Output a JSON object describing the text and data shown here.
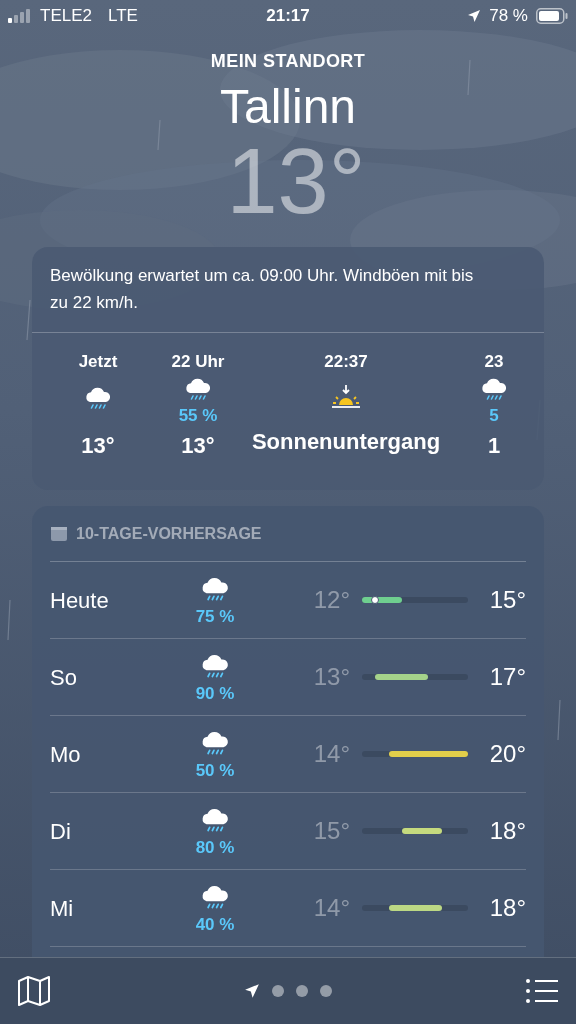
{
  "status_bar": {
    "carrier": "TELE2",
    "network": "LTE",
    "time": "21:17",
    "battery": "78 %"
  },
  "header": {
    "caption": "MEIN STANDORT",
    "city": "Tallinn",
    "temperature": "13°"
  },
  "hourly": {
    "summary": "Bewölkung erwartet um ca. 09:00 Uhr. Windböen mit bis zu 22 km/h.",
    "items": [
      {
        "kind": "hour",
        "time": "Jetzt",
        "temperature": "13°"
      },
      {
        "kind": "hour",
        "time": "22 Uhr",
        "precipitation": "55 %",
        "temperature": "13°"
      },
      {
        "kind": "sunset",
        "time": "22:37",
        "label": "Sonnenuntergang"
      },
      {
        "kind": "hour",
        "time": "23",
        "precipitation": "5",
        "temperature": "1"
      }
    ]
  },
  "forecast": {
    "title": "10-TAGE-VORHERSAGE",
    "days": [
      {
        "day": "Heute",
        "precipitation": "75 %",
        "low": "12°",
        "high": "15°",
        "color": "#6fcf8f",
        "current": true
      },
      {
        "day": "So",
        "precipitation": "90 %",
        "low": "13°",
        "high": "17°",
        "color": "#a5d38a",
        "current": false
      },
      {
        "day": "Mo",
        "precipitation": "50 %",
        "low": "14°",
        "high": "20°",
        "color": "#e3cf4a",
        "current": false
      },
      {
        "day": "Di",
        "precipitation": "80 %",
        "low": "15°",
        "high": "18°",
        "color": "#c5da7e",
        "current": false
      },
      {
        "day": "Mi",
        "precipitation": "40 %",
        "low": "14°",
        "high": "18°",
        "color": "#bcd884",
        "current": false
      }
    ]
  },
  "pages": [
    {
      "kind": "location",
      "selected": true
    },
    {
      "kind": "dot",
      "selected": false
    },
    {
      "kind": "dot",
      "selected": false
    },
    {
      "kind": "dot",
      "selected": false
    }
  ]
}
